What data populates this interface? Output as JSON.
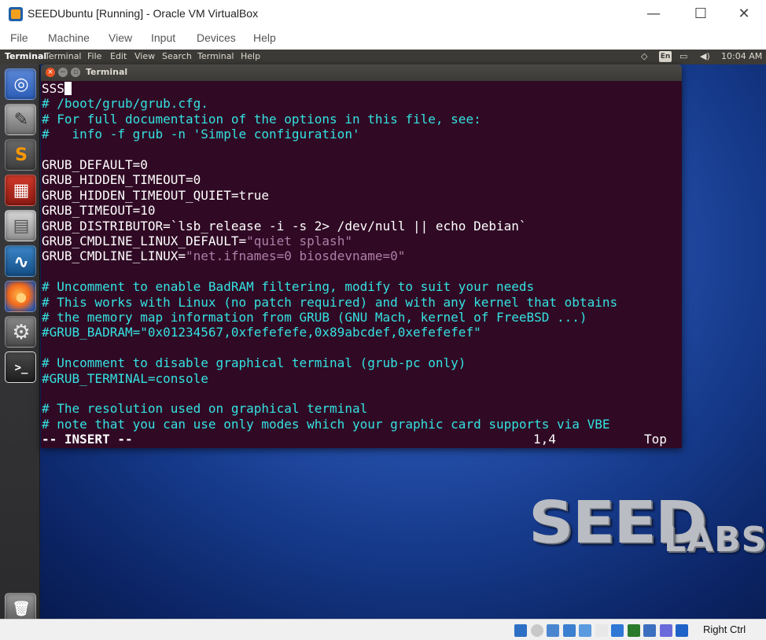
{
  "window": {
    "title": "SEEDUbuntu [Running] - Oracle VM VirtualBox",
    "minimize_glyph": "—",
    "maximize_glyph": "☐",
    "close_glyph": "✕"
  },
  "vbox_menu": [
    "File",
    "Machine",
    "View",
    "Input",
    "Devices",
    "Help"
  ],
  "ubuntu_panel": {
    "app_name": "Terminal",
    "menus": [
      "Terminal",
      "File",
      "Edit",
      "View",
      "Search",
      "Terminal",
      "Help"
    ],
    "keyboard_layout": "En",
    "clock": "10:04 AM"
  },
  "launcher": {
    "items": [
      {
        "name": "ubuntu-dash-icon",
        "glyph": "◎"
      },
      {
        "name": "text-editor-icon",
        "glyph": "✎"
      },
      {
        "name": "sublime-text-icon",
        "glyph": "S"
      },
      {
        "name": "terminal-red-icon",
        "glyph": "▦"
      },
      {
        "name": "file-cabinet-icon",
        "glyph": "▤"
      },
      {
        "name": "wireshark-icon",
        "glyph": "∿"
      },
      {
        "name": "firefox-icon",
        "glyph": "●"
      },
      {
        "name": "settings-icon",
        "glyph": "⚙"
      },
      {
        "name": "terminal-icon",
        "glyph": ">_"
      },
      {
        "name": "trash-icon",
        "glyph": "🗑"
      }
    ]
  },
  "terminal": {
    "title": "Terminal",
    "lines": [
      {
        "parts": [
          {
            "t": "SSS",
            "c": ""
          }
        ],
        "cursor": true
      },
      {
        "parts": [
          {
            "t": "# /boot/grub/grub.cfg.",
            "c": "cmt"
          }
        ]
      },
      {
        "parts": [
          {
            "t": "# For full documentation of the options in this file, see:",
            "c": "cmt"
          }
        ]
      },
      {
        "parts": [
          {
            "t": "#   info -f grub -n 'Simple configuration'",
            "c": "cmt"
          }
        ]
      },
      {
        "parts": [
          {
            "t": "",
            "c": ""
          }
        ]
      },
      {
        "parts": [
          {
            "t": "GRUB_DEFAULT=0",
            "c": ""
          }
        ]
      },
      {
        "parts": [
          {
            "t": "GRUB_HIDDEN_TIMEOUT=0",
            "c": ""
          }
        ]
      },
      {
        "parts": [
          {
            "t": "GRUB_HIDDEN_TIMEOUT_QUIET=true",
            "c": ""
          }
        ]
      },
      {
        "parts": [
          {
            "t": "GRUB_TIMEOUT=10",
            "c": ""
          }
        ]
      },
      {
        "parts": [
          {
            "t": "GRUB_DISTRIBUTOR=`lsb_release -i -s 2> /dev/null || echo Debian`",
            "c": ""
          }
        ]
      },
      {
        "parts": [
          {
            "t": "GRUB_CMDLINE_LINUX_DEFAULT=",
            "c": ""
          },
          {
            "t": "\"quiet splash\"",
            "c": "str"
          }
        ]
      },
      {
        "parts": [
          {
            "t": "GRUB_CMDLINE_LINUX=",
            "c": ""
          },
          {
            "t": "\"net.ifnames=0 biosdevname=0\"",
            "c": "str"
          }
        ]
      },
      {
        "parts": [
          {
            "t": "",
            "c": ""
          }
        ]
      },
      {
        "parts": [
          {
            "t": "# Uncomment to enable BadRAM filtering, modify to suit your needs",
            "c": "cmt"
          }
        ]
      },
      {
        "parts": [
          {
            "t": "# This works with Linux (no patch required) and with any kernel that obtains",
            "c": "cmt"
          }
        ]
      },
      {
        "parts": [
          {
            "t": "# the memory map information from GRUB (GNU Mach, kernel of FreeBSD ...)",
            "c": "cmt"
          }
        ]
      },
      {
        "parts": [
          {
            "t": "#GRUB_BADRAM=\"0x01234567,0xfefefefe,0x89abcdef,0xefefefef\"",
            "c": "cmt"
          }
        ]
      },
      {
        "parts": [
          {
            "t": "",
            "c": ""
          }
        ]
      },
      {
        "parts": [
          {
            "t": "# Uncomment to disable graphical terminal (grub-pc only)",
            "c": "cmt"
          }
        ]
      },
      {
        "parts": [
          {
            "t": "#GRUB_TERMINAL=console",
            "c": "cmt"
          }
        ]
      },
      {
        "parts": [
          {
            "t": "",
            "c": ""
          }
        ]
      },
      {
        "parts": [
          {
            "t": "# The resolution used on graphical terminal",
            "c": "cmt"
          }
        ]
      },
      {
        "parts": [
          {
            "t": "# note that you can use only modes which your graphic card supports via VBE",
            "c": "cmt"
          }
        ]
      }
    ],
    "status": {
      "mode": "-- INSERT --",
      "position": "1,4",
      "scroll": "Top"
    },
    "colors": {
      "background": "#300a24",
      "comment": "#34e2e2",
      "string": "#ad7fa8",
      "text": "#ffffff"
    }
  },
  "desktop": {
    "logo_big": "SEED",
    "logo_small": "LABS"
  },
  "vbox_status": {
    "host_key": "Right Ctrl",
    "icons": [
      "hard-disk-icon",
      "optical-disk-icon",
      "audio-icon",
      "network-icon",
      "usb-icon",
      "shared-folder-icon",
      "display-icon",
      "video-capture-icon",
      "cpu-icon",
      "mouse-integration-icon",
      "keyboard-icon"
    ]
  }
}
